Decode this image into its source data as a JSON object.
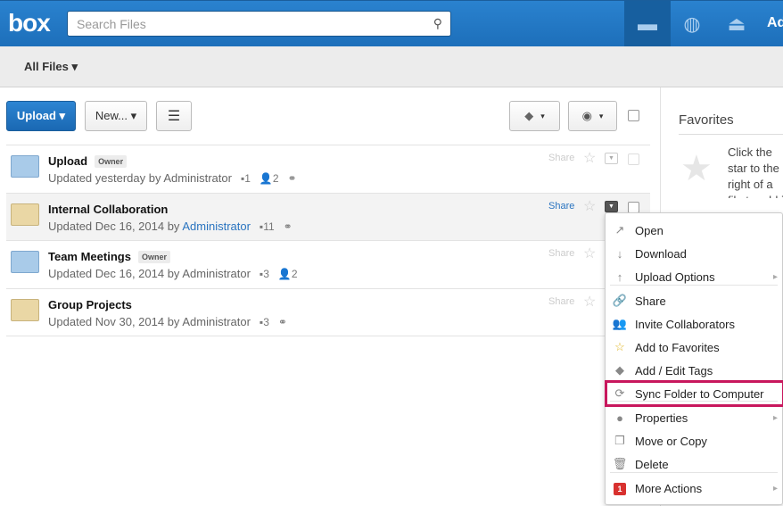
{
  "header": {
    "logo": "box",
    "search_placeholder": "Search Files",
    "admin": "Admin"
  },
  "subnav": {
    "all_files": "All Files ▾"
  },
  "toolbar": {
    "upload": "Upload ▾",
    "new": "New... ▾",
    "tag": "▾",
    "view": "▾"
  },
  "files": [
    {
      "name": "Upload",
      "badge": "Owner",
      "updated": "Updated yesterday by ",
      "user": "Administrator",
      "files": "1",
      "collab": "2",
      "link": true,
      "share": "Share",
      "shared": true
    },
    {
      "name": "Internal Collaboration",
      "badge": "",
      "updated": "Updated Dec 16, 2014 by ",
      "user": "Administrator",
      "files": "11",
      "collab": "",
      "link": true,
      "share": "Share",
      "shared": false
    },
    {
      "name": "Team Meetings",
      "badge": "Owner",
      "updated": "Updated Dec 16, 2014 by ",
      "user": "Administrator",
      "files": "3",
      "collab": "2",
      "link": false,
      "share": "Share",
      "shared": true
    },
    {
      "name": "Group Projects",
      "badge": "",
      "updated": "Updated Nov 30, 2014 by ",
      "user": "Administrator",
      "files": "3",
      "collab": "",
      "link": true,
      "share": "Share",
      "shared": false
    }
  ],
  "sidebar": {
    "title": "Favorites",
    "text": "Click the star to the right of a file to add it here"
  },
  "menu": [
    {
      "label": "Open",
      "icon": "↗"
    },
    {
      "label": "Download",
      "icon": "↓"
    },
    {
      "label": "Upload Options",
      "icon": "↑",
      "sub": true
    },
    {
      "label": "Share",
      "icon": "🔗"
    },
    {
      "label": "Invite Collaborators",
      "icon": "👥"
    },
    {
      "label": "Add to Favorites",
      "icon": "☆"
    },
    {
      "label": "Add / Edit Tags",
      "icon": "◆"
    },
    {
      "label": "Sync Folder to Computer",
      "icon": "⟳"
    },
    {
      "label": "Properties",
      "icon": "●",
      "sub": true
    },
    {
      "label": "Move or Copy",
      "icon": "❐"
    },
    {
      "label": "Delete",
      "icon": "🗑"
    },
    {
      "label": "More Actions",
      "icon": "1",
      "sub": true
    }
  ]
}
